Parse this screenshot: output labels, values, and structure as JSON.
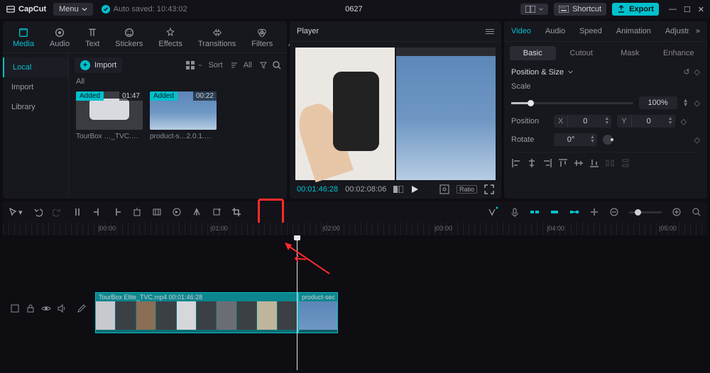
{
  "titlebar": {
    "app_name": "CapCut",
    "menu_label": "Menu",
    "autosave_label": "Auto saved: 10:43:02",
    "project_title": "0627",
    "shortcut_label": "Shortcut",
    "export_label": "Export"
  },
  "media_tabs": [
    "Media",
    "Audio",
    "Text",
    "Stickers",
    "Effects",
    "Transitions",
    "Filters",
    "Adjustment"
  ],
  "media_side": {
    "items": [
      "Local",
      "Import",
      "Library"
    ],
    "active": 0
  },
  "media_toolbar": {
    "import_label": "Import",
    "sort_label": "Sort",
    "all_label": "All",
    "section_label": "All"
  },
  "clips": [
    {
      "badge": "Added",
      "duration": "01:47",
      "name": "TourBox …_TVC.mp4"
    },
    {
      "badge": "Added",
      "duration": "00:22",
      "name": "product-s…2.0.1.mp4"
    }
  ],
  "player": {
    "title": "Player",
    "time_current": "00:01:46:28",
    "time_total": "00:02:08:06",
    "ratio_label": "Ratio"
  },
  "inspector": {
    "tabs": [
      "Video",
      "Audio",
      "Speed",
      "Animation",
      "Adjustment"
    ],
    "subtabs": [
      "Basic",
      "Cutout",
      "Mask",
      "Enhance"
    ],
    "section": "Position & Size",
    "scale": {
      "label": "Scale",
      "value": "100%"
    },
    "position": {
      "label": "Position",
      "x_label": "X",
      "x_val": "0",
      "y_label": "Y",
      "y_val": "0"
    },
    "rotate": {
      "label": "Rotate",
      "value": "0°"
    }
  },
  "toolbar": {
    "crop_tooltip": "Crop"
  },
  "ruler": {
    "t0": "00:00",
    "t1": "01:00",
    "t2": "02:00",
    "t3": "03:00",
    "t4": "04:00",
    "t5": "05:00"
  },
  "timeline": {
    "clip1_label": "TourBox Elite_TVC.mp4  00:01:46:28",
    "clip2_label": "product-sec"
  }
}
